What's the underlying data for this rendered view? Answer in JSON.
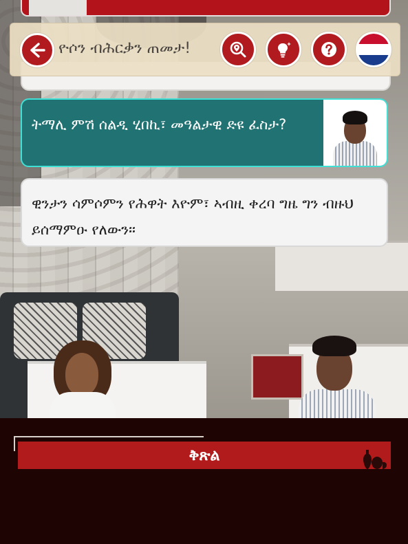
{
  "header": {
    "title": "ዮሶን ብሕርቃን ጠመታ!"
  },
  "icons": {
    "back": "arrow-left-icon",
    "explore": "search-location-icon",
    "hint": "lightbulb-icon",
    "help": "question-mark-icon",
    "language": "netherlands-flag-icon"
  },
  "dialogue": {
    "player_line": "ትማሊ ምሽ ሰልዲ ሂበኪ፣ መዓልታዊ ድዩ ፈስታ?",
    "npc_line": "ዊንታን ሳምሶምን የሕዋት እዮም፣ ኣብዚ ቀረባ ግዜ ግን ብዙህ ይሰማምዑ የለውን።"
  },
  "actions": {
    "continue_label": "ቅጽል"
  },
  "colors": {
    "accent_red": "#b11b20",
    "player_bubble": "#217272",
    "player_border": "#3fe0d6",
    "toolbar_bg": "#ecdfc4",
    "panel_bg": "#1e0503"
  }
}
